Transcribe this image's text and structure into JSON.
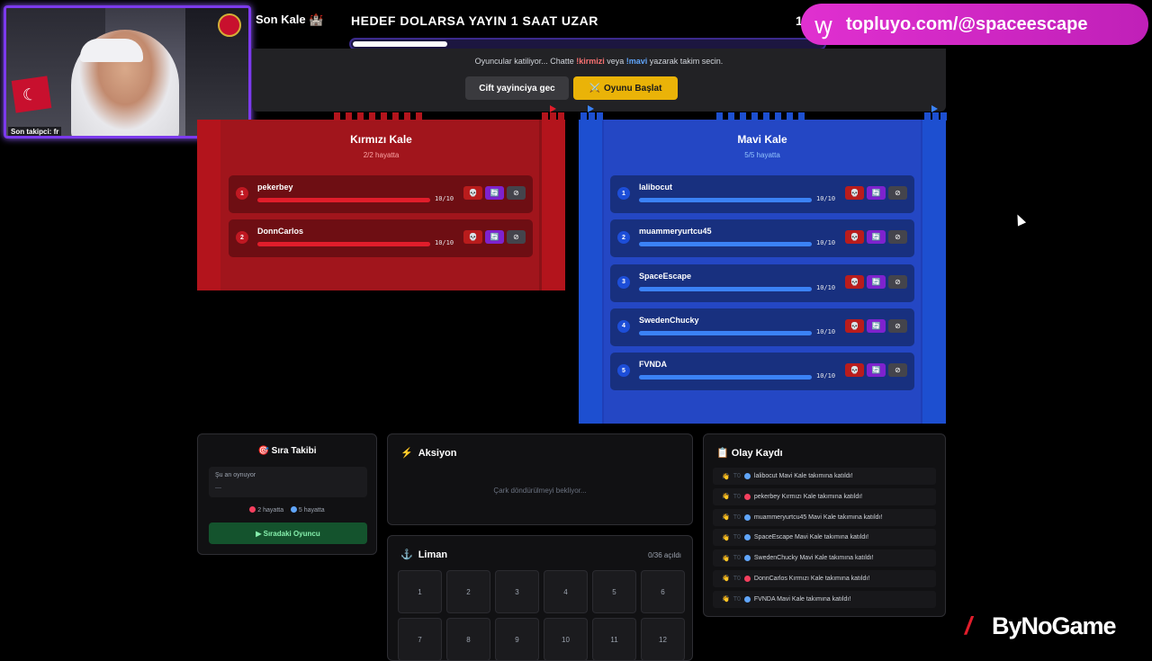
{
  "webcam": {
    "overlay_label": "Son takipci: fr"
  },
  "topbar": {
    "title": "Son Kale 🏰",
    "banner": "HEDEF DOLARSA YAYIN 1 SAAT UZAR",
    "banner_number": "1",
    "progress_fraction": 0.2
  },
  "link": {
    "icon": "tiktok-icon",
    "text": "topluyo.com/@spaceescape"
  },
  "control": {
    "hint_prefix": "Oyuncular katiliyor... Chatte ",
    "hint_red": "!kirmizi",
    "hint_mid": " veya ",
    "hint_blue": "!mavi",
    "hint_suffix": " yazarak takim secin.",
    "dual_button": "Cift yayinciya gec",
    "start_icon": "⚔️",
    "start_button": "Oyunu Başlat"
  },
  "red_team": {
    "name": "Kırmızı Kale",
    "status": "2/2 hayatta",
    "color": "#a1151c",
    "players": [
      {
        "num": "1",
        "name": "pekerbey",
        "hp": "10/10"
      },
      {
        "num": "2",
        "name": "DonnCarlos",
        "hp": "10/10"
      }
    ]
  },
  "blue_team": {
    "name": "Mavi Kale",
    "status": "5/5 hayatta",
    "color": "#2447c4",
    "players": [
      {
        "num": "1",
        "name": "lalibocut",
        "hp": "10/10"
      },
      {
        "num": "2",
        "name": "muammeryurtcu45",
        "hp": "10/10"
      },
      {
        "num": "3",
        "name": "SpaceEscape",
        "hp": "10/10"
      },
      {
        "num": "4",
        "name": "SwedenChucky",
        "hp": "10/10"
      },
      {
        "num": "5",
        "name": "FVNDA",
        "hp": "10/10"
      }
    ]
  },
  "player_actions": {
    "kill": "💀",
    "swap": "🔄",
    "ban": "⊘"
  },
  "queue": {
    "title": "🎯 Sıra Takibi",
    "now_label": "Şu an oynuyor",
    "now_value": "—",
    "red_alive": "2 hayatta",
    "blue_alive": "5 hayatta",
    "next_button": "▶ Sıradaki Oyuncu"
  },
  "action": {
    "icon": "⚡",
    "title": "Aksiyon",
    "message": "Çark döndürülmeyi bekliyor..."
  },
  "harbor": {
    "icon": "⚓",
    "title": "Liman",
    "count": "0/36 açıldı",
    "cells": [
      "1",
      "2",
      "3",
      "4",
      "5",
      "6",
      "7",
      "8",
      "9",
      "10",
      "11",
      "12"
    ]
  },
  "log": {
    "title": "📋 Olay Kaydı",
    "time": "T0",
    "entries": [
      {
        "team": "blue",
        "text": "lalibocut Mavi Kale takımına katıldı!"
      },
      {
        "team": "red",
        "text": "pekerbey Kırmızı Kale takımına katıldı!"
      },
      {
        "team": "blue",
        "text": "muammeryurtcu45 Mavi Kale takımına katıldı!"
      },
      {
        "team": "blue",
        "text": "SpaceEscape Mavi Kale takımına katıldı!"
      },
      {
        "team": "blue",
        "text": "SwedenChucky Mavi Kale takımına katıldı!"
      },
      {
        "team": "red",
        "text": "DonnCarlos Kırmızı Kale takımına katıldı!"
      },
      {
        "team": "blue",
        "text": "FVNDA Mavi Kale takımına katıldı!"
      }
    ]
  },
  "logo": {
    "mark": "/",
    "text": "ByNoGame"
  },
  "colors": {
    "red": "#e11d2b",
    "blue": "#3b82f6",
    "gold": "#eab308",
    "accent": "#c020b8"
  }
}
